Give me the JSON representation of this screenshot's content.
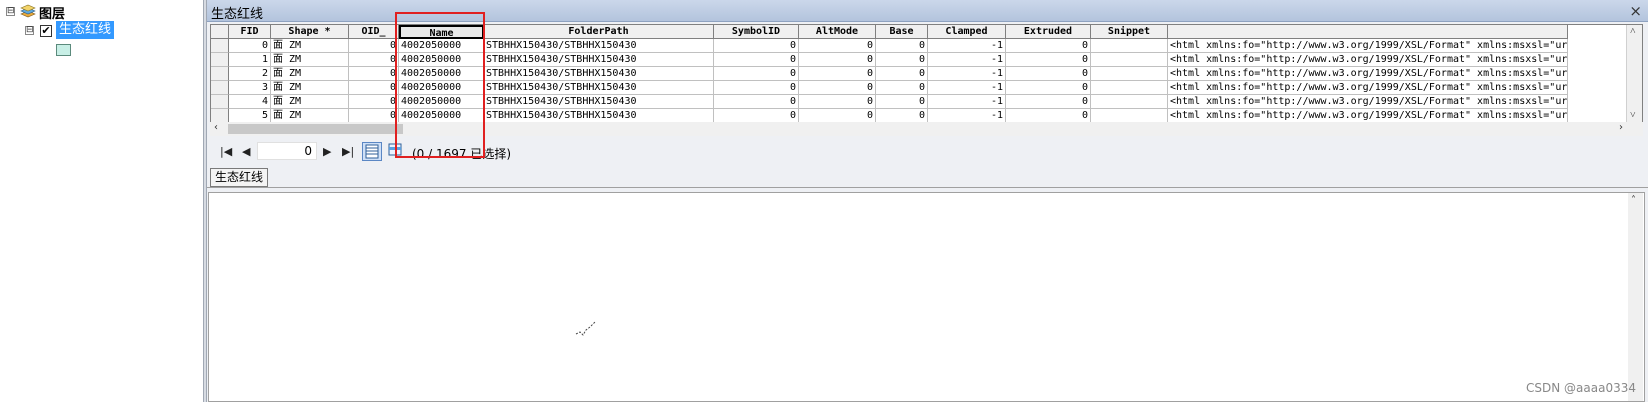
{
  "toc": {
    "root_label": "图层",
    "layer_label": "生态红线",
    "layer_checked": "✔",
    "expander": "⊟"
  },
  "window": {
    "title": "生态红线",
    "close": "×"
  },
  "table": {
    "columns": [
      "FID",
      "Shape *",
      "OID_",
      "Name",
      "FolderPath",
      "SymbolID",
      "AltMode",
      "Base",
      "Clamped",
      "Extruded",
      "Snippet",
      ""
    ],
    "rows": [
      [
        "0",
        "面 ZM",
        "0",
        "4002050000",
        "STBHHX150430/STBHHX150430",
        "0",
        "0",
        "0",
        "-1",
        "0",
        "",
        "<html xmlns:fo=\"http://www.w3.org/1999/XSL/Format\" xmlns:msxsl=\"urn:"
      ],
      [
        "1",
        "面 ZM",
        "0",
        "4002050000",
        "STBHHX150430/STBHHX150430",
        "0",
        "0",
        "0",
        "-1",
        "0",
        "",
        "<html xmlns:fo=\"http://www.w3.org/1999/XSL/Format\" xmlns:msxsl=\"urn:"
      ],
      [
        "2",
        "面 ZM",
        "0",
        "4002050000",
        "STBHHX150430/STBHHX150430",
        "0",
        "0",
        "0",
        "-1",
        "0",
        "",
        "<html xmlns:fo=\"http://www.w3.org/1999/XSL/Format\" xmlns:msxsl=\"urn:"
      ],
      [
        "3",
        "面 ZM",
        "0",
        "4002050000",
        "STBHHX150430/STBHHX150430",
        "0",
        "0",
        "0",
        "-1",
        "0",
        "",
        "<html xmlns:fo=\"http://www.w3.org/1999/XSL/Format\" xmlns:msxsl=\"urn:"
      ],
      [
        "4",
        "面 ZM",
        "0",
        "4002050000",
        "STBHHX150430/STBHHX150430",
        "0",
        "0",
        "0",
        "-1",
        "0",
        "",
        "<html xmlns:fo=\"http://www.w3.org/1999/XSL/Format\" xmlns:msxsl=\"urn:"
      ],
      [
        "5",
        "面 ZM",
        "0",
        "4002050000",
        "STBHHX150430/STBHHX150430",
        "0",
        "0",
        "0",
        "-1",
        "0",
        "",
        "<html xmlns:fo=\"http://www.w3.org/1999/XSL/Format\" xmlns:msxsl=\"urn:"
      ]
    ]
  },
  "navigator": {
    "current_record": "0",
    "selection_text": "(0 / 1697 已选择)"
  },
  "tab": {
    "label": "生态红线"
  },
  "watermark": "CSDN @aaaa0334",
  "colors": {
    "highlight": "#e02020",
    "selected_layer": "#3399ff"
  }
}
